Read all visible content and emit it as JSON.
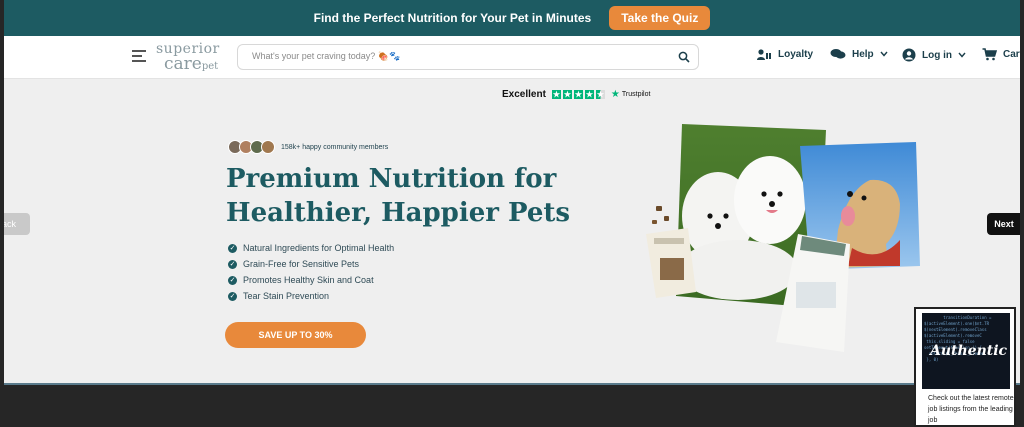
{
  "promo": {
    "text": "Find the Perfect Nutrition for Your Pet in Minutes",
    "quiz_button": "Take the Quiz"
  },
  "header": {
    "logo": {
      "line1": "superior",
      "line2": "care",
      "line3": "pet"
    },
    "search_placeholder": "What's your pet craving today? 🍖🐾",
    "nav": {
      "loyalty": "Loyalty",
      "help": "Help",
      "login": "Log in",
      "cart": "Cart"
    }
  },
  "rating": {
    "label": "Excellent",
    "stars": 4.5,
    "provider": "Trustpilot"
  },
  "hero": {
    "community": "158k+ happy community members",
    "headline_line1": "Premium Nutrition for",
    "headline_line2": "Healthier, Happier Pets",
    "benefits": [
      "Natural Ingredients for Optimal Health",
      "Grain-Free for Sensitive Pets",
      "Promotes Healthy Skin and Coat",
      "Tear Stain Prevention"
    ],
    "cta": "SAVE UP TO 30%"
  },
  "carousel": {
    "back": "Back",
    "next": "Next"
  },
  "ad": {
    "brand": "Authentic",
    "description": "Check out the latest remote job listings from the leading job"
  },
  "colors": {
    "brand_teal": "#1d5b62",
    "accent_orange": "#e8893b",
    "trustpilot_green": "#00b67a"
  }
}
